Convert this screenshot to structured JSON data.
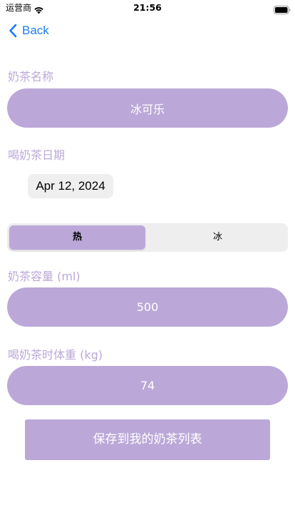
{
  "status_bar": {
    "carrier": "运营商",
    "time": "21:56"
  },
  "nav": {
    "back_label": "Back"
  },
  "form": {
    "name_label": "奶茶名称",
    "name_value": "冰可乐",
    "date_label": "喝奶茶日期",
    "date_value": "Apr 12, 2024",
    "temperature": {
      "options": [
        "热",
        "冰"
      ],
      "selected": "热"
    },
    "volume_label": "奶茶容量 (ml)",
    "volume_value": "500",
    "weight_label": "喝奶茶时体重 (kg)",
    "weight_value": "74"
  },
  "save_button_label": "保存到我的奶茶列表",
  "colors": {
    "accent": "#bba8d8",
    "link": "#1a7cf5",
    "segment_background": "#eeeeee",
    "date_chip_background": "#efefef"
  }
}
